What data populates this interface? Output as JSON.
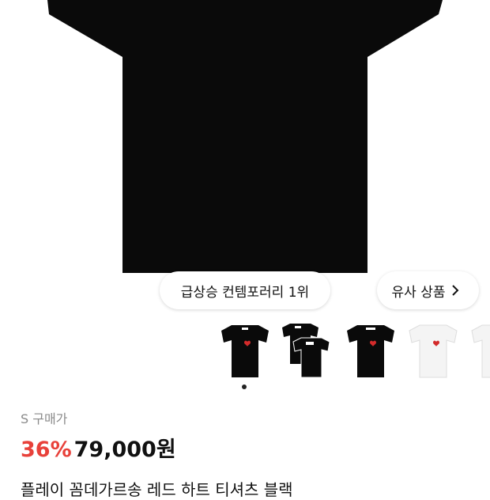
{
  "hero": {
    "image": "black-tshirt-product-photo"
  },
  "badges": {
    "rank_label": "급상승 컨템포러리 1위",
    "similar_label": "유사 상품"
  },
  "thumbnails": [
    {
      "name": "black-tshirt-red-heart"
    },
    {
      "name": "black-tshirt-two-pack"
    },
    {
      "name": "black-tshirt-red-heart-2"
    },
    {
      "name": "white-tshirt-red-heart"
    },
    {
      "name": "white-tshirt-partial"
    }
  ],
  "carousel": {
    "active_index": 0
  },
  "pricing": {
    "label": "S 구매가",
    "discount": "36%",
    "price": "79,000원"
  },
  "product": {
    "name": "플레이 꼼데가르송 레드 하트 티셔츠 블랙"
  },
  "colors": {
    "accent": "#e8413a",
    "shirt_black": "#0a0a0a"
  }
}
